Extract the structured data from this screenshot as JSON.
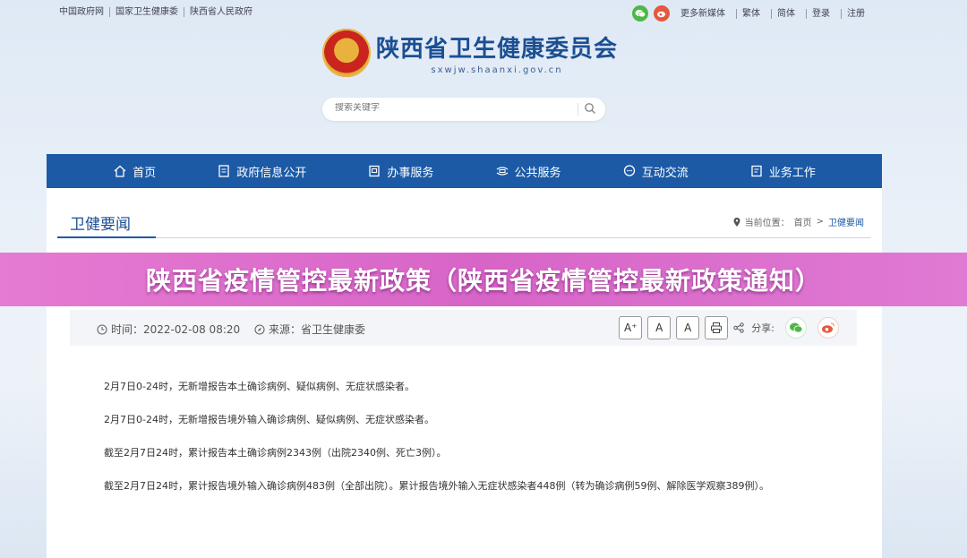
{
  "top_links": [
    "中国政府网",
    "国家卫生健康委",
    "陕西省人民政府"
  ],
  "top_right": {
    "new_media": "更多新媒体",
    "traditional": "繁体",
    "simplified": "简体",
    "login": "登录",
    "register": "注册"
  },
  "site": {
    "title": "陕西省卫生健康委员会",
    "domain": "sxwjw.shaanxi.gov.cn"
  },
  "search": {
    "placeholder": "搜索关键字"
  },
  "nav": [
    {
      "label": "首页",
      "icon": "home-icon"
    },
    {
      "label": "政府信息公开",
      "icon": "document-icon"
    },
    {
      "label": "办事服务",
      "icon": "service-icon"
    },
    {
      "label": "公共服务",
      "icon": "public-icon"
    },
    {
      "label": "互动交流",
      "icon": "chat-icon"
    },
    {
      "label": "业务工作",
      "icon": "work-icon"
    }
  ],
  "section": {
    "title": "卫健要闻",
    "breadcrumb_label": "当前位置：",
    "breadcrumb_home": "首页",
    "breadcrumb_sep": ">",
    "breadcrumb_current": "卫健要闻"
  },
  "overlay_title": "陕西省疫情管控最新政策（陕西省疫情管控最新政策通知）",
  "meta": {
    "time": "时间：2022-02-08 08:20",
    "source": "来源：省卫生健康委",
    "font_large": "A⁺",
    "font_medium": "A",
    "font_small": "A",
    "share_label": "分享:"
  },
  "article": [
    "2月7日0-24时，无新增报告本土确诊病例、疑似病例、无症状感染者。",
    "2月7日0-24时，无新增报告境外输入确诊病例、疑似病例、无症状感染者。",
    "截至2月7日24时，累计报告本土确诊病例2343例（出院2340例、死亡3例）。",
    "截至2月7日24时，累计报告境外输入确诊病例483例（全部出院）。累计报告境外输入无症状感染者448例（转为确诊病例59例、解除医学观察389例）。"
  ],
  "colors": {
    "nav_bg": "#1c5aa6",
    "overlay": "#d765c8",
    "brand_text": "#1b4f93"
  }
}
